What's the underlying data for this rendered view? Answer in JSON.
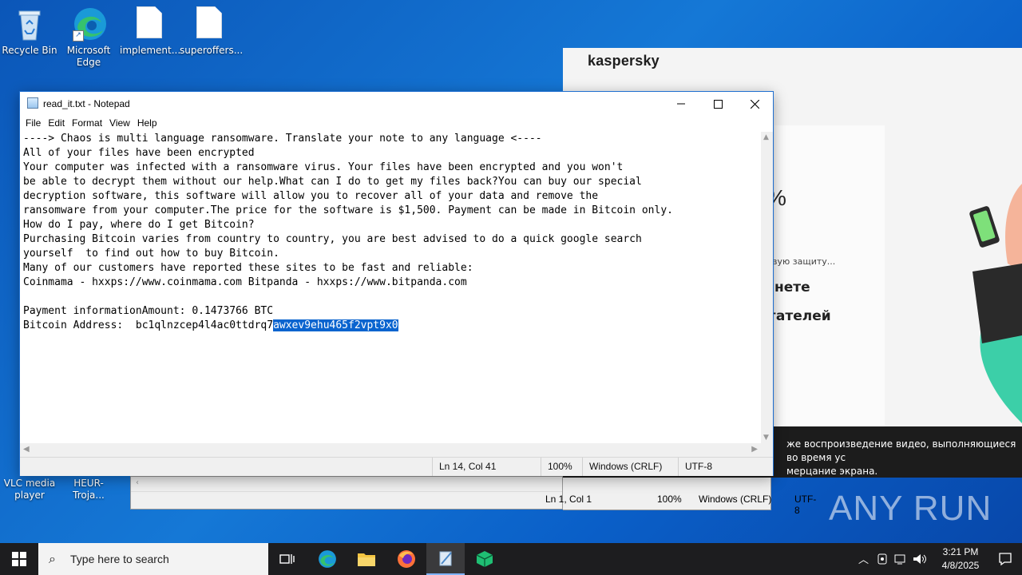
{
  "desktop": {
    "icons": [
      {
        "label": "Recycle Bin"
      },
      {
        "label": "Microsoft Edge"
      },
      {
        "label": "implement..."
      },
      {
        "label": "superoffers..."
      },
      {
        "label": "VLC media player"
      },
      {
        "label": "HEUR-Troja..."
      }
    ]
  },
  "kaspersky": {
    "logo": "kaspersky",
    "big_text": "%",
    "small_text": "вую защиту...",
    "title_1": "нете",
    "title_2": "гателей",
    "notice": "же воспроизведение видео, выполняющиеся во время ус\nмерцание экрана."
  },
  "notepad": {
    "title": "read_it.txt - Notepad",
    "menu": [
      "File",
      "Edit",
      "Format",
      "View",
      "Help"
    ],
    "lines": [
      "----> Chaos is multi language ransomware. Translate your note to any language <----",
      "All of your files have been encrypted",
      "Your computer was infected with a ransomware virus. Your files have been encrypted and you won't",
      "be able to decrypt them without our help.What can I do to get my files back?You can buy our special",
      "decryption software, this software will allow you to recover all of your data and remove the",
      "ransomware from your computer.The price for the software is $1,500. Payment can be made in Bitcoin only.",
      "How do I pay, where do I get Bitcoin?",
      "Purchasing Bitcoin varies from country to country, you are best advised to do a quick google search",
      "yourself  to find out how to buy Bitcoin.",
      "Many of our customers have reported these sites to be fast and reliable:",
      "Coinmama - hxxps://www.coinmama.com Bitpanda - hxxps://www.bitpanda.com",
      "",
      "Payment informationAmount: 0.1473766 BTC"
    ],
    "address_prefix": "Bitcoin Address:  bc1qlnzcep4l4ac0ttdrq7",
    "address_selected": "awxev9ehu465f2vpt9x0",
    "status": {
      "position": "Ln 14, Col 41",
      "zoom": "100%",
      "line_ending": "Windows (CRLF)",
      "encoding": "UTF-8"
    }
  },
  "notepad_back": {
    "status": {
      "position": "Ln 1, Col 1",
      "zoom": "100%",
      "line_ending": "Windows (CRLF)",
      "encoding": "UTF-8"
    }
  },
  "watermark": "ANY RUN",
  "taskbar": {
    "search_placeholder": "Type here to search",
    "time": "3:21 PM",
    "date": "4/8/2025"
  }
}
